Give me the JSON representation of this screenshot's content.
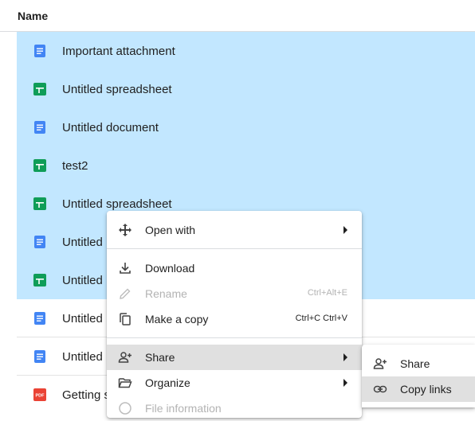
{
  "header": {
    "name_label": "Name"
  },
  "files": [
    {
      "name": "Important attachment",
      "type": "doc",
      "selected": true
    },
    {
      "name": "Untitled spreadsheet",
      "type": "sheet",
      "selected": true
    },
    {
      "name": "Untitled document",
      "type": "doc",
      "selected": true
    },
    {
      "name": "test2",
      "type": "sheet",
      "selected": true
    },
    {
      "name": "Untitled spreadsheet",
      "type": "sheet",
      "selected": true
    },
    {
      "name": "Untitled",
      "type": "doc",
      "selected": true
    },
    {
      "name": "Untitled",
      "type": "sheet",
      "selected": true
    },
    {
      "name": "Untitled",
      "type": "doc",
      "selected": false
    },
    {
      "name": "Untitled",
      "type": "doc",
      "selected": false
    },
    {
      "name": "Getting s",
      "type": "pdf",
      "selected": false
    }
  ],
  "context_menu": {
    "open_with": "Open with",
    "download": "Download",
    "rename": "Rename",
    "rename_shortcut": "Ctrl+Alt+E",
    "make_copy": "Make a copy",
    "make_copy_shortcut": "Ctrl+C Ctrl+V",
    "share": "Share",
    "organize": "Organize",
    "file_information": "File information"
  },
  "share_submenu": {
    "share": "Share",
    "copy_links": "Copy links"
  },
  "colors": {
    "selection": "#c2e7ff",
    "doc_blue": "#4285f4",
    "sheet_green": "#0f9d58",
    "pdf_red": "#ea4335",
    "menu_highlight": "#e0e0e0"
  },
  "icons": {
    "open_with": "move-arrows-icon",
    "download": "download-icon",
    "rename": "pencil-icon",
    "make_copy": "copy-icon",
    "share": "person-add-icon",
    "organize": "folder-open-icon",
    "file_information": "info-icon",
    "copy_links": "link-icon"
  }
}
